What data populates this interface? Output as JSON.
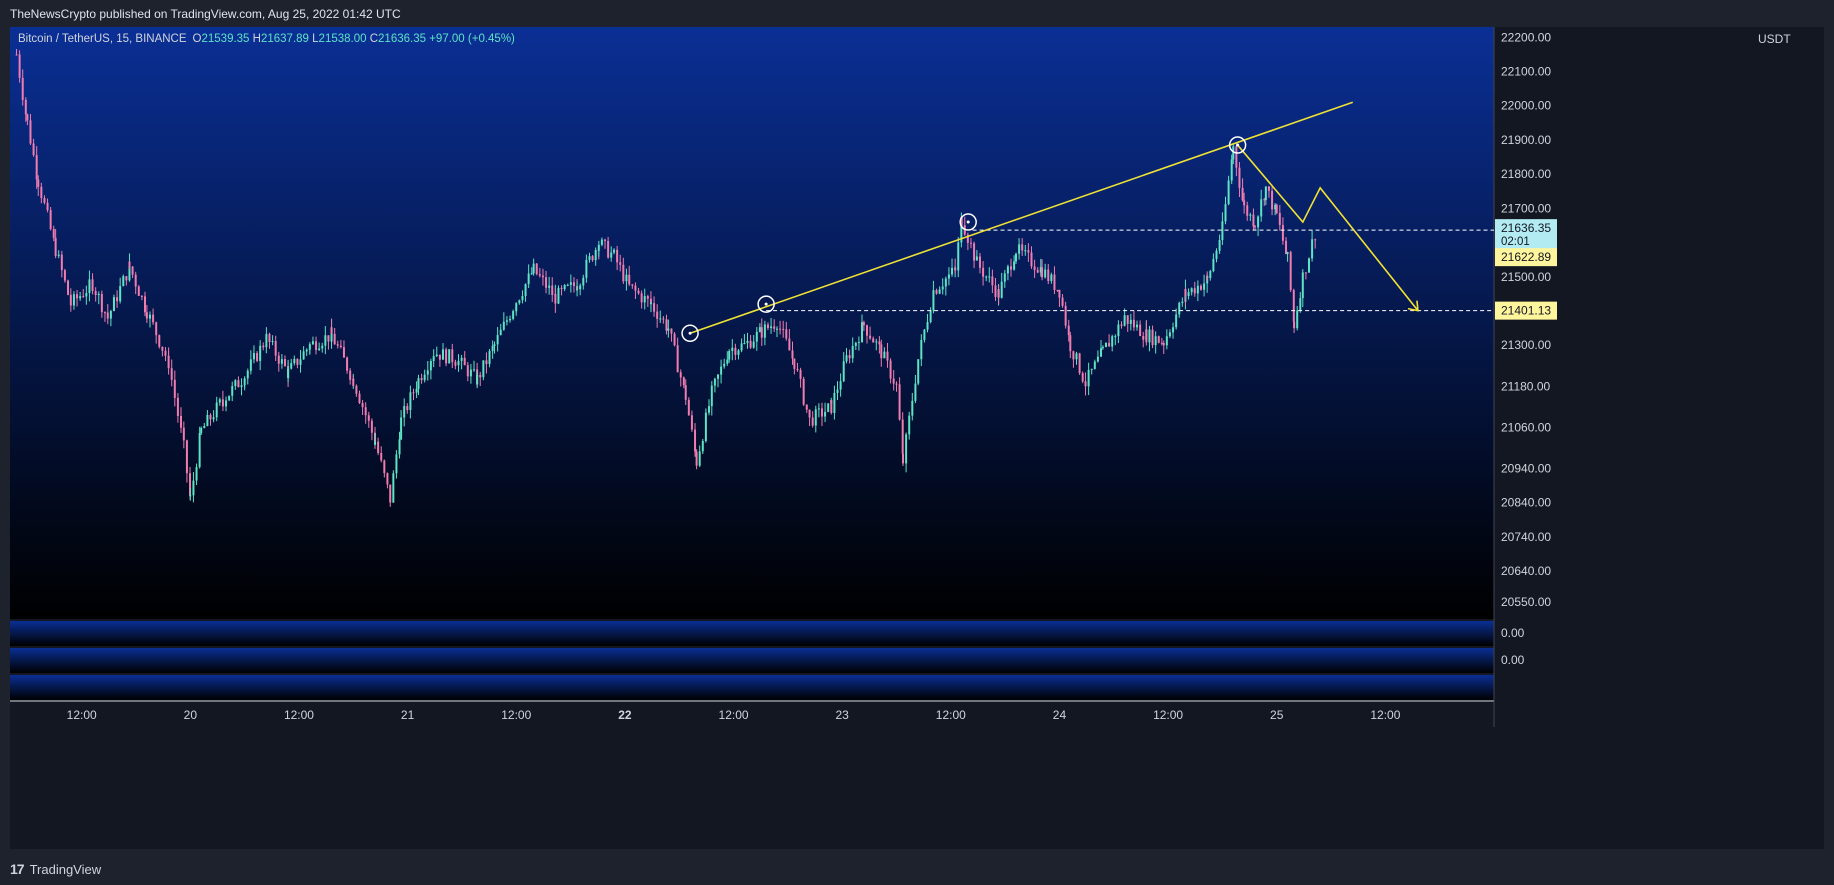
{
  "header": {
    "publisher_line": "TheNewsCrypto published on TradingView.com, Aug 25, 2022 01:42 UTC"
  },
  "legend": {
    "symbol": "Bitcoin / TetherUS, 15, BINANCE",
    "open_label": "O",
    "open": "21539.35",
    "high_label": "H",
    "high": "21637.89",
    "low_label": "L",
    "low": "21538.00",
    "close_label": "C",
    "close": "21636.35",
    "change": "+97.00 (+0.45%)"
  },
  "footer": {
    "brand": "TradingView",
    "logo_glyph": "17"
  },
  "colors": {
    "up": "#5ee3c4",
    "down": "#f07cb0",
    "drawing": "#f0e234",
    "bg_top": "#0a2f95",
    "bg_bottom": "#000000",
    "last_price_tag": "#b2ebf2",
    "level_tag": "#fff59d"
  },
  "chart_data": {
    "type": "candlestick",
    "symbol": "BTCUSDT",
    "interval": "15",
    "exchange": "BINANCE",
    "currency": "USDT",
    "ylim": [
      20500,
      22230
    ],
    "y_ticks": [
      "22200.00",
      "22100.00",
      "22000.00",
      "21900.00",
      "21800.00",
      "21700.00",
      "21500.00",
      "21300.00",
      "21180.00",
      "21060.00",
      "20940.00",
      "20840.00",
      "20740.00",
      "20640.00",
      "20550.00"
    ],
    "y_tick_values": [
      22200,
      22100,
      22000,
      21900,
      21800,
      21700,
      21500,
      21300,
      21180,
      21060,
      20940,
      20840,
      20740,
      20640,
      20550
    ],
    "x_ticks": [
      "12:00",
      "20",
      "12:00",
      "21",
      "12:00",
      "22",
      "12:00",
      "23",
      "12:00",
      "24",
      "12:00",
      "25",
      "12:00"
    ],
    "x_tick_days": [
      19.5,
      20,
      20.5,
      21,
      21.5,
      22,
      22.5,
      23,
      23.5,
      24,
      24.5,
      25,
      25.5
    ],
    "x_bold_tick": "22",
    "xlim_days": [
      19.17,
      26.0
    ],
    "last_price": {
      "value": 21636.35,
      "label": "21636.35",
      "countdown": "02:01"
    },
    "level_tags": [
      {
        "value": 21622.89,
        "label": "21622.89"
      },
      {
        "value": 21401.13,
        "label": "21401.13"
      }
    ],
    "series": [
      {
        "day": 19.2,
        "close": 22150
      },
      {
        "day": 19.25,
        "close": 21950
      },
      {
        "day": 19.3,
        "close": 21780
      },
      {
        "day": 19.38,
        "close": 21580
      },
      {
        "day": 19.45,
        "close": 21420
      },
      {
        "day": 19.55,
        "close": 21480
      },
      {
        "day": 19.62,
        "close": 21380
      },
      {
        "day": 19.72,
        "close": 21530
      },
      {
        "day": 19.8,
        "close": 21400
      },
      {
        "day": 19.9,
        "close": 21250
      },
      {
        "day": 19.97,
        "close": 21000
      },
      {
        "day": 20.0,
        "close": 20850
      },
      {
        "day": 20.05,
        "close": 21050
      },
      {
        "day": 20.15,
        "close": 21140
      },
      {
        "day": 20.25,
        "close": 21210
      },
      {
        "day": 20.35,
        "close": 21320
      },
      {
        "day": 20.45,
        "close": 21220
      },
      {
        "day": 20.55,
        "close": 21300
      },
      {
        "day": 20.65,
        "close": 21330
      },
      {
        "day": 20.75,
        "close": 21200
      },
      {
        "day": 20.85,
        "close": 21020
      },
      {
        "day": 20.92,
        "close": 20850
      },
      {
        "day": 20.97,
        "close": 21080
      },
      {
        "day": 21.05,
        "close": 21200
      },
      {
        "day": 21.12,
        "close": 21280
      },
      {
        "day": 21.22,
        "close": 21260
      },
      {
        "day": 21.32,
        "close": 21200
      },
      {
        "day": 21.4,
        "close": 21300
      },
      {
        "day": 21.5,
        "close": 21430
      },
      {
        "day": 21.58,
        "close": 21520
      },
      {
        "day": 21.68,
        "close": 21440
      },
      {
        "day": 21.78,
        "close": 21480
      },
      {
        "day": 21.88,
        "close": 21600
      },
      {
        "day": 21.95,
        "close": 21560
      },
      {
        "day": 22.02,
        "close": 21470
      },
      {
        "day": 22.12,
        "close": 21420
      },
      {
        "day": 22.2,
        "close": 21350
      },
      {
        "day": 22.28,
        "close": 21150
      },
      {
        "day": 22.33,
        "close": 20960
      },
      {
        "day": 22.4,
        "close": 21160
      },
      {
        "day": 22.48,
        "close": 21290
      },
      {
        "day": 22.55,
        "close": 21300
      },
      {
        "day": 22.63,
        "close": 21340
      },
      {
        "day": 22.7,
        "close": 21370
      },
      {
        "day": 22.78,
        "close": 21250
      },
      {
        "day": 22.85,
        "close": 21080
      },
      {
        "day": 22.95,
        "close": 21120
      },
      {
        "day": 23.02,
        "close": 21260
      },
      {
        "day": 23.1,
        "close": 21360
      },
      {
        "day": 23.18,
        "close": 21280
      },
      {
        "day": 23.25,
        "close": 21180
      },
      {
        "day": 23.28,
        "close": 20960
      },
      {
        "day": 23.35,
        "close": 21260
      },
      {
        "day": 23.42,
        "close": 21460
      },
      {
        "day": 23.52,
        "close": 21520
      },
      {
        "day": 23.55,
        "close": 21670
      },
      {
        "day": 23.62,
        "close": 21540
      },
      {
        "day": 23.72,
        "close": 21450
      },
      {
        "day": 23.8,
        "close": 21580
      },
      {
        "day": 23.92,
        "close": 21520
      },
      {
        "day": 24.0,
        "close": 21460
      },
      {
        "day": 24.05,
        "close": 21300
      },
      {
        "day": 24.12,
        "close": 21190
      },
      {
        "day": 24.2,
        "close": 21280
      },
      {
        "day": 24.3,
        "close": 21380
      },
      {
        "day": 24.4,
        "close": 21330
      },
      {
        "day": 24.48,
        "close": 21310
      },
      {
        "day": 24.58,
        "close": 21450
      },
      {
        "day": 24.68,
        "close": 21490
      },
      {
        "day": 24.75,
        "close": 21640
      },
      {
        "day": 24.8,
        "close": 21880
      },
      {
        "day": 24.85,
        "close": 21700
      },
      {
        "day": 24.9,
        "close": 21660
      },
      {
        "day": 24.95,
        "close": 21760
      },
      {
        "day": 25.0,
        "close": 21680
      },
      {
        "day": 25.05,
        "close": 21550
      },
      {
        "day": 25.08,
        "close": 21360
      },
      {
        "day": 25.12,
        "close": 21500
      },
      {
        "day": 25.18,
        "close": 21636.35
      }
    ],
    "drawings": {
      "trendline": {
        "from": {
          "day": 22.3,
          "price": 21335
        },
        "to": {
          "day": 25.35,
          "price": 22010
        }
      },
      "projection": [
        {
          "day": 24.82,
          "price": 21885
        },
        {
          "day": 25.12,
          "price": 21660
        },
        {
          "day": 25.2,
          "price": 21760
        },
        {
          "day": 25.65,
          "price": 21401.13
        }
      ],
      "touch_points": [
        {
          "day": 22.3,
          "price": 21335
        },
        {
          "day": 22.65,
          "price": 21420
        },
        {
          "day": 23.58,
          "price": 21660
        },
        {
          "day": 24.82,
          "price": 21885
        }
      ],
      "dashed_levels": [
        {
          "price": 21636.35,
          "from_day": 23.6
        },
        {
          "price": 21401.13,
          "from_day": 22.65
        }
      ]
    },
    "indicator_panes": [
      {
        "label": "0.00"
      },
      {
        "label": "0.00"
      }
    ]
  }
}
